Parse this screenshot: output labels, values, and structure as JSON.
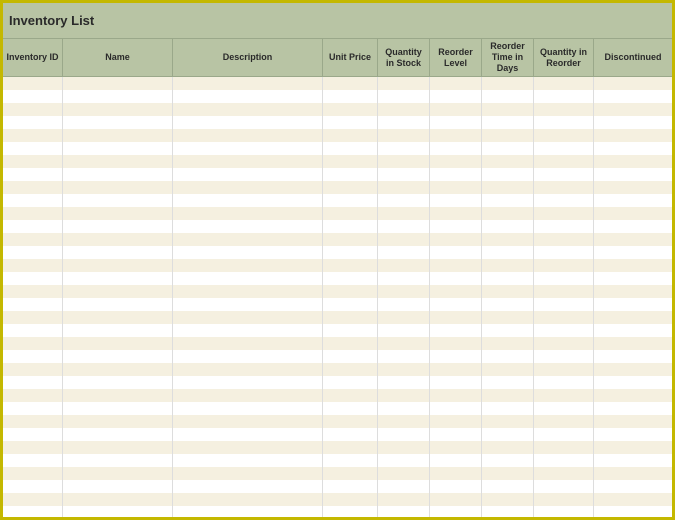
{
  "title": "Inventory List",
  "columns": [
    "Inventory ID",
    "Name",
    "Description",
    "Unit Price",
    "Quantity in Stock",
    "Reorder Level",
    "Reorder Time in Days",
    "Quantity in Reorder",
    "Discontinued"
  ],
  "row_count": 34,
  "colors": {
    "border": "#c4b800",
    "header_bg": "#b8c4a4",
    "stripe": "#f5f0e0"
  }
}
